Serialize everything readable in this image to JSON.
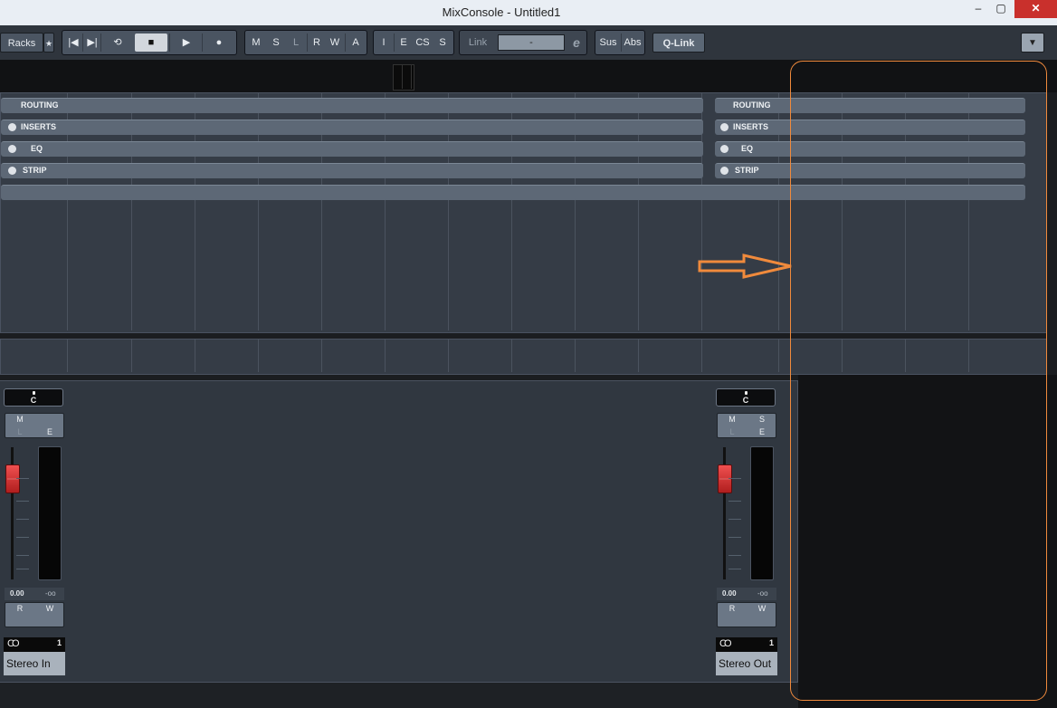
{
  "window": {
    "title": "MixConsole - Untitled1",
    "min": "–",
    "max": "▢",
    "close": "✕"
  },
  "toolbar": {
    "racks": "Racks",
    "star": "★",
    "transport": [
      "|◀",
      "▶|",
      "⟲",
      "■",
      "▶",
      "●"
    ],
    "state_buttons": [
      "M",
      "S",
      "L",
      "R",
      "W",
      "A"
    ],
    "filter_buttons": [
      "I",
      "E",
      "CS",
      "S"
    ],
    "link_label": "Link",
    "link_value": "-",
    "link_icon": "e",
    "sus": "Sus",
    "abs": "Abs",
    "qlink": "Q-Link",
    "dropdown_icon": "▼"
  },
  "racks": {
    "left": [
      {
        "label": "ROUTING",
        "radio": false
      },
      {
        "label": "INSERTS",
        "radio": true
      },
      {
        "label": "EQ",
        "radio": true
      },
      {
        "label": "STRIP",
        "radio": true
      }
    ],
    "right": [
      {
        "label": "ROUTING",
        "radio": false
      },
      {
        "label": "INSERTS",
        "radio": true
      },
      {
        "label": "EQ",
        "radio": true
      },
      {
        "label": "STRIP",
        "radio": true
      }
    ]
  },
  "channels": [
    {
      "pan": "C",
      "buttons": [
        "M",
        "",
        "L",
        "E"
      ],
      "volume": "0.00",
      "peak": "-oo",
      "rw": [
        "R",
        "W"
      ],
      "io_icon": "CO",
      "io_number": "1",
      "name": "Stereo In"
    },
    {
      "pan": "C",
      "buttons": [
        "M",
        "S",
        "L",
        "E"
      ],
      "volume": "0.00",
      "peak": "-oo",
      "rw": [
        "R",
        "W"
      ],
      "io_icon": "CO",
      "io_number": "1",
      "name": "Stereo Out"
    }
  ],
  "colors": {
    "highlight": "#f08a3c",
    "fader": "#e03a3a"
  }
}
